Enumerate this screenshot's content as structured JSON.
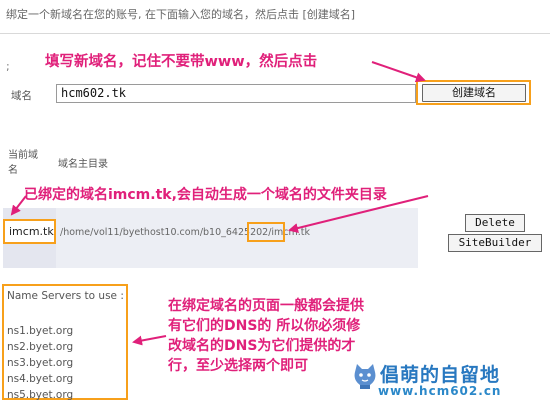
{
  "intro_text": "绑定一个新域名在您的账号, 在下面输入您的域名，然后点击 [创建域名]",
  "semicolon": ";",
  "annotations": {
    "top": "填写新域名，记住不要带www，然后点击",
    "middle": "已绑定的域名imcm.tk,会自动生成一个域名的文件夹目录",
    "bottom": [
      "在绑定域名的页面一般都会提供",
      "有它们的DNS的  所以你必须修",
      "改域名的DNS为它们提供的才",
      "行，至少选择两个即可"
    ]
  },
  "form": {
    "domain_label": "域名",
    "domain_value": "hcm602.tk",
    "create_button": "创建域名"
  },
  "table": {
    "headers": [
      "当前域名",
      "域名主目录"
    ],
    "row": {
      "domain": "imcm.tk",
      "path": "/home/vol11/byethost10.com/b10_6425202/imcm.tk",
      "delete_button": "Delete",
      "sitebuilder_button": "SiteBuilder"
    }
  },
  "name_servers": {
    "title": "Name Servers to use :",
    "items": [
      "ns1.byet.org",
      "ns2.byet.org",
      "ns3.byet.org",
      "ns4.byet.org",
      "ns5.byet.org"
    ]
  },
  "watermark": {
    "line1": "倡萌的自留地",
    "line2": "www.hcm602.cn"
  },
  "colors": {
    "annotation": "#e0207a",
    "highlight_border": "#f7a01b",
    "watermark": "#2878c0"
  }
}
